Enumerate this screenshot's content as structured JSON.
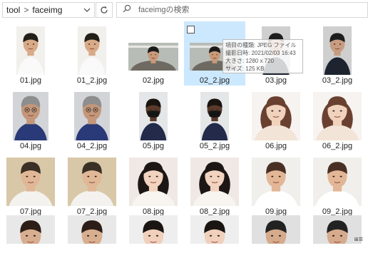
{
  "address": {
    "crumbs": [
      "tool",
      "faceimg"
    ],
    "separator": ">"
  },
  "search": {
    "placeholder": "faceimgの検索"
  },
  "files": [
    {
      "name": "01.jpg",
      "bg": "#f2f0ec",
      "skin": "#d8aa88",
      "hair": "#222018",
      "shirt": "#fafafa",
      "variant": "portrait"
    },
    {
      "name": "01_2.jpg",
      "bg": "#f2f0ec",
      "skin": "#d8aa88",
      "hair": "#222018",
      "shirt": "#fafafa",
      "variant": "portrait"
    },
    {
      "name": "02.jpg",
      "bg": "#b8bcb6",
      "skin": "#c89a7a",
      "hair": "#1c1a18",
      "shirt": "#6e6a62",
      "variant": "wide"
    },
    {
      "name": "02_2.jpg",
      "bg": "#b8bcb6",
      "skin": "#c89a7a",
      "hair": "#1c1a18",
      "shirt": "#6e6a62",
      "variant": "wide"
    },
    {
      "name": "03.jpg",
      "bg": "#cfcfcf",
      "skin": "#c79c80",
      "hair": "#1d1d1d",
      "shirt": "#1d2430",
      "variant": "portrait"
    },
    {
      "name": "03_2.jpg",
      "bg": "#cfcfcf",
      "skin": "#c79c80",
      "hair": "#1d1d1d",
      "shirt": "#1d2430",
      "variant": "portrait"
    },
    {
      "name": "04.jpg",
      "bg": "#d2d4d8",
      "skin": "#c4977a",
      "hair": "#8e8e8e",
      "shirt": "#2a3a78",
      "variant": "portrait-glasses"
    },
    {
      "name": "04_2.jpg",
      "bg": "#d2d4d8",
      "skin": "#c4977a",
      "hair": "#8e8e8e",
      "shirt": "#2a3a78",
      "variant": "portrait-glasses"
    },
    {
      "name": "05.jpg",
      "bg": "#e4e6e8",
      "skin": "#5a3a2a",
      "hair": "#1a1410",
      "shirt": "#232a4a",
      "variant": "portrait-mask"
    },
    {
      "name": "05_2.jpg",
      "bg": "#e4e6e8",
      "skin": "#5a3a2a",
      "hair": "#1a1410",
      "shirt": "#232a4a",
      "variant": "portrait-mask"
    },
    {
      "name": "06.jpg",
      "bg": "#f6f3f0",
      "skin": "#f0d2bd",
      "hair": "#6a4030",
      "shirt": "#f3e4d8",
      "variant": "square-long"
    },
    {
      "name": "06_2.jpg",
      "bg": "#f6f3f0",
      "skin": "#f0d2bd",
      "hair": "#6a4030",
      "shirt": "#f3e4d8",
      "variant": "square-long"
    },
    {
      "name": "07.jpg",
      "bg": "#d9c8a8",
      "skin": "#e0b898",
      "hair": "#3a3026",
      "shirt": "#f4f2ee",
      "variant": "square"
    },
    {
      "name": "07_2.jpg",
      "bg": "#d9c8a8",
      "skin": "#e0b898",
      "hair": "#3a3026",
      "shirt": "#f4f2ee",
      "variant": "square"
    },
    {
      "name": "08.jpg",
      "bg": "#efe8e4",
      "skin": "#f2d3c0",
      "hair": "#1c1614",
      "shirt": "#f8f4f0",
      "variant": "square-long"
    },
    {
      "name": "08_2.jpg",
      "bg": "#efe8e4",
      "skin": "#f2d3c0",
      "hair": "#1c1614",
      "shirt": "#f8f4f0",
      "variant": "square-long"
    },
    {
      "name": "09.jpg",
      "bg": "#f0efec",
      "skin": "#e2b696",
      "hair": "#4a3024",
      "shirt": "#ffffff",
      "variant": "square"
    },
    {
      "name": "09_2.jpg",
      "bg": "#f0efec",
      "skin": "#e2b696",
      "hair": "#4a3024",
      "shirt": "#ffffff",
      "variant": "square"
    },
    {
      "name": "",
      "bg": "#e8e8e8",
      "skin": "#d8ae90",
      "hair": "#2c1e16",
      "shirt": "#ffffff",
      "variant": "partial"
    },
    {
      "name": "",
      "bg": "#e8e8e8",
      "skin": "#d8ae90",
      "hair": "#2c1e16",
      "shirt": "#ffffff",
      "variant": "partial"
    },
    {
      "name": "",
      "bg": "#eeeeee",
      "skin": "#f0d0bc",
      "hair": "#1a1412",
      "shirt": "#ffffff",
      "variant": "partial"
    },
    {
      "name": "",
      "bg": "#eeeeee",
      "skin": "#f0d0bc",
      "hair": "#1a1412",
      "shirt": "#ffffff",
      "variant": "partial"
    },
    {
      "name": "",
      "bg": "#e0e0e0",
      "skin": "#d6aa8c",
      "hair": "#222222",
      "shirt": "#ffffff",
      "variant": "partial"
    },
    {
      "name": "",
      "bg": "#e0e0e0",
      "skin": "#d6aa8c",
      "hair": "#222222",
      "shirt": "#ffffff",
      "variant": "partial"
    }
  ],
  "selected_index": 3,
  "tooltip": {
    "type": "項目の種類: JPEG ファイル",
    "date": "撮影日時: 2021/02/03 16:43",
    "dimensions": "大きさ: 1280 x 720",
    "size": "サイズ: 125 KB"
  },
  "status": {
    "corner": "⊞☰"
  }
}
